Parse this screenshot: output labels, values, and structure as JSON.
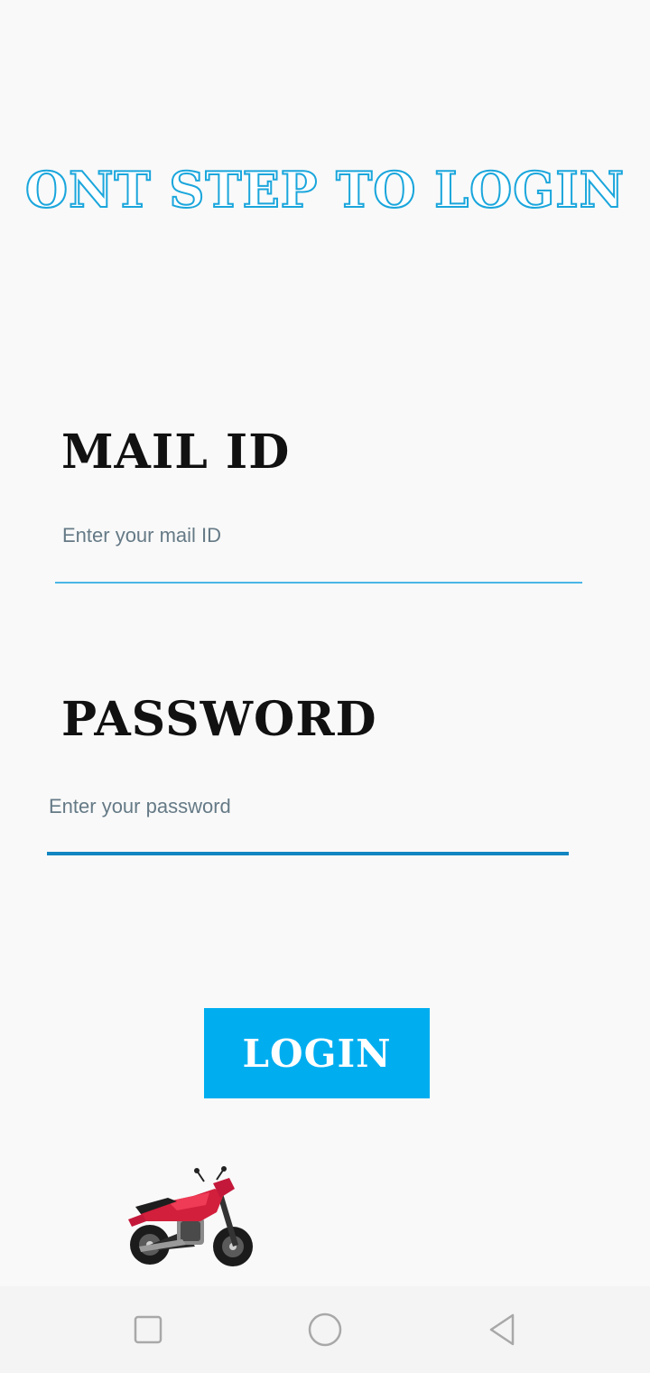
{
  "header": {
    "title": "ONT STEP TO LOGIN"
  },
  "form": {
    "mail_label": "MAIL ID",
    "mail_placeholder": "Enter your mail ID",
    "mail_value": "",
    "password_label": "PASSWORD",
    "password_placeholder": "Enter your password",
    "password_value": "",
    "login_label": "LOGIN"
  },
  "image": {
    "icon": "motorcycle-icon"
  },
  "navbar": {
    "items": [
      {
        "icon": "recent-apps-icon"
      },
      {
        "icon": "home-icon"
      },
      {
        "icon": "back-icon"
      }
    ]
  },
  "colors": {
    "accent": "#00aef0",
    "title_outline": "#1aa6dc",
    "underline_mail": "#49b6e6",
    "underline_password": "#1186c1",
    "background": "#f9f9f9"
  }
}
